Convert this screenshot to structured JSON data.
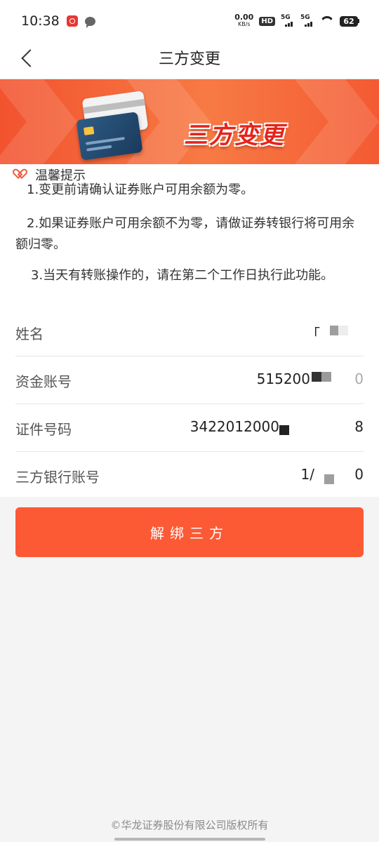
{
  "status_bar": {
    "time": "10:38",
    "net_speed": "0.00",
    "net_unit": "KB/s",
    "hd_label": "HD",
    "sim1_label": "5G",
    "sim2_label": "5G",
    "battery": "62"
  },
  "nav": {
    "title": "三方变更"
  },
  "banner": {
    "text": "三方变更"
  },
  "tips": {
    "heading": "温馨提示",
    "items": [
      "1.变更前请确认证券账户可用余额为零。",
      "2.如果证券账户可用余额不为零，请做证券转银行将可用余额归零。",
      "3.当天有转账操作的，请在第二个工作日执行此功能。"
    ]
  },
  "info": {
    "rows": [
      {
        "label": "姓名",
        "value": "「"
      },
      {
        "label": "资金账号",
        "value": "515200"
      },
      {
        "label": "证件号码",
        "value": "3422012000"
      },
      {
        "label": "三方银行账号",
        "value": "1/"
      }
    ],
    "masked_tails": [
      "",
      "0",
      "8",
      "0"
    ]
  },
  "actions": {
    "unbind_label": "解绑三方"
  },
  "footer": {
    "copyright": "©华龙证券股份有限公司版权所有"
  }
}
